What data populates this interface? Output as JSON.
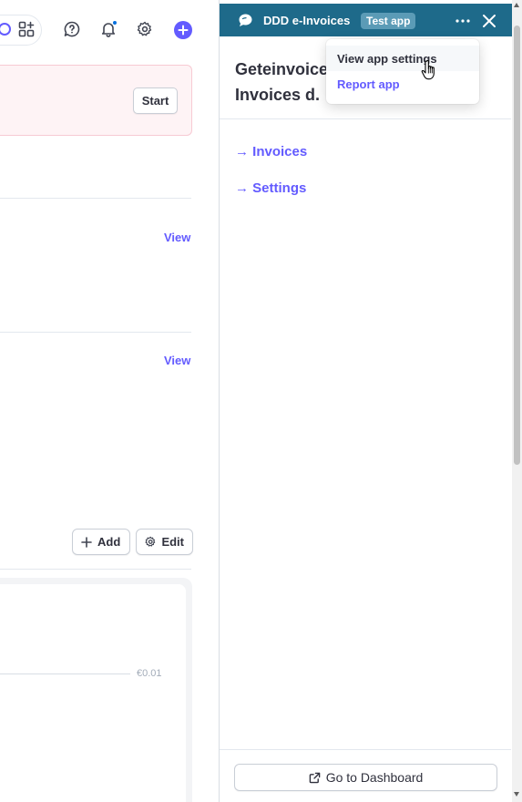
{
  "panel": {
    "app_name": "DDD e-Invoices",
    "badge": "Test app",
    "title_line1": "Geteinvoice",
    "title_line2": "Invoices d.",
    "links": [
      {
        "label": "→ Invoices"
      },
      {
        "label": "→ Settings"
      }
    ],
    "footer_button": "Go to Dashboard"
  },
  "dropdown": {
    "items": [
      {
        "label": "View app settings"
      },
      {
        "label": "Report app"
      }
    ]
  },
  "dashboard": {
    "banner_button": "Start",
    "view_label_1": "View",
    "view_label_2": "View",
    "add_button": "Add",
    "edit_button": "Edit",
    "chart_tick": "€0.01"
  },
  "colors": {
    "header": "#1e6a8a",
    "accent": "#635bff",
    "banner_bg": "#fef3f5"
  },
  "icons": [
    "search-ring-icon",
    "apps-icon",
    "help-icon",
    "bell-icon",
    "gear-icon",
    "plus-icon",
    "chat-bubble-icon",
    "more-icon",
    "close-icon",
    "external-link-icon",
    "pointer-cursor-icon"
  ]
}
